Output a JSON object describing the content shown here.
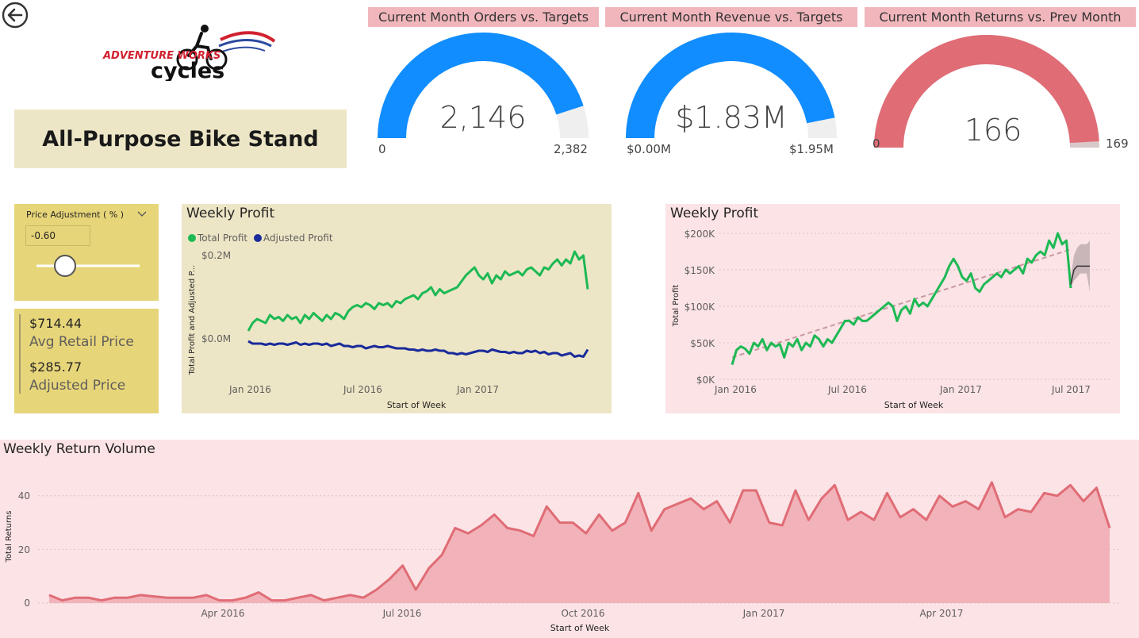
{
  "colors": {
    "gauge_blue": "#118dff",
    "gauge_red": "#e06c75",
    "gauge_track": "#efefef",
    "total_profit": "#1db954",
    "adjusted_profit": "#1a2b9b",
    "returns": "#e06c75",
    "returns_fill": "#f1b3b9"
  },
  "header": {
    "back_icon": "back-arrow-icon",
    "logo_line1": "ADVENTURE WORKS",
    "logo_line2": "cycles",
    "product_name": "All-Purpose Bike Stand"
  },
  "kpis": [
    {
      "title": "Current Month Orders vs. Targets",
      "value": "2,146",
      "min": "0",
      "max": "2,382",
      "fraction": 0.901
    },
    {
      "title": "Current Month Revenue vs. Targets",
      "value": "$1.83M",
      "min": "$0.00M",
      "max": "$1.95M",
      "fraction": 0.938
    },
    {
      "title": "Current Month Returns vs. Prev Month",
      "value": "166",
      "min": "0",
      "max": "169",
      "fraction": 0.982
    }
  ],
  "slicer": {
    "title": "Price Adjustment ( % )",
    "value": "-0.60",
    "slider_fraction": 0.2
  },
  "price_card": {
    "avg_retail_value": "$714.44",
    "avg_retail_label": "Avg Retail Price",
    "adjusted_value": "$285.77",
    "adjusted_label": "Adjusted Price"
  },
  "chart_data": [
    {
      "id": "weekly_profit_adjusted",
      "type": "line",
      "title": "Weekly Profit",
      "legend": [
        "Total Profit",
        "Adjusted Profit"
      ],
      "legend_position": "top-left",
      "xlabel": "Start of Week",
      "ylabel": "Total Profit and Adjusted P...",
      "x_ticks": [
        "Jan 2016",
        "Jul 2016",
        "Jan 2017"
      ],
      "y_ticks": [
        "$0.2M",
        "$0.0M"
      ],
      "ylim": [
        -0.1,
        0.25
      ],
      "x_start": "2016-01-03",
      "x_step_days": 7,
      "series": [
        {
          "name": "Total Profit",
          "values": [
            0.02,
            0.04,
            0.05,
            0.045,
            0.04,
            0.06,
            0.05,
            0.055,
            0.045,
            0.06,
            0.05,
            0.055,
            0.04,
            0.06,
            0.05,
            0.065,
            0.055,
            0.045,
            0.06,
            0.05,
            0.065,
            0.06,
            0.05,
            0.07,
            0.08,
            0.085,
            0.08,
            0.09,
            0.085,
            0.075,
            0.09,
            0.085,
            0.09,
            0.08,
            0.095,
            0.09,
            0.1,
            0.105,
            0.11,
            0.1,
            0.115,
            0.12,
            0.13,
            0.11,
            0.125,
            0.115,
            0.12,
            0.125,
            0.13,
            0.145,
            0.16,
            0.17,
            0.18,
            0.16,
            0.15,
            0.165,
            0.14,
            0.16,
            0.15,
            0.17,
            0.16,
            0.165,
            0.17,
            0.16,
            0.175,
            0.18,
            0.17,
            0.16,
            0.18,
            0.175,
            0.19,
            0.2,
            0.185,
            0.2,
            0.19,
            0.22,
            0.2,
            0.21,
            0.125
          ]
        },
        {
          "name": "Adjusted Profit",
          "values": [
            -0.01,
            -0.02,
            -0.02,
            -0.02,
            -0.025,
            -0.02,
            -0.025,
            -0.02,
            -0.02,
            -0.025,
            -0.02,
            -0.015,
            -0.025,
            -0.02,
            -0.025,
            -0.02,
            -0.02,
            -0.025,
            -0.02,
            -0.03,
            -0.025,
            -0.02,
            -0.03,
            -0.03,
            -0.035,
            -0.03,
            -0.03,
            -0.04,
            -0.035,
            -0.03,
            -0.035,
            -0.035,
            -0.03,
            -0.035,
            -0.04,
            -0.04,
            -0.04,
            -0.045,
            -0.045,
            -0.05,
            -0.045,
            -0.05,
            -0.05,
            -0.045,
            -0.05,
            -0.05,
            -0.06,
            -0.06,
            -0.065,
            -0.06,
            -0.065,
            -0.06,
            -0.055,
            -0.05,
            -0.05,
            -0.055,
            -0.045,
            -0.05,
            -0.055,
            -0.055,
            -0.06,
            -0.055,
            -0.06,
            -0.06,
            -0.05,
            -0.055,
            -0.05,
            -0.06,
            -0.055,
            -0.065,
            -0.06,
            -0.06,
            -0.07,
            -0.065,
            -0.06,
            -0.075,
            -0.07,
            -0.075,
            -0.045
          ]
        }
      ]
    },
    {
      "id": "weekly_profit_forecast",
      "type": "line",
      "title": "Weekly Profit",
      "xlabel": "Start of Week",
      "ylabel": "Total Profit",
      "x_ticks": [
        "Jan 2016",
        "Jul 2016",
        "Jan 2017",
        "Jul 2017"
      ],
      "y_ticks": [
        "$200K",
        "$150K",
        "$100K",
        "$50K",
        "$0K"
      ],
      "ylim": [
        0,
        200
      ],
      "x_start": "2016-01-03",
      "x_step_days": 7,
      "grid": true,
      "series": [
        {
          "name": "Total Profit",
          "values": [
            20,
            40,
            45,
            42,
            35,
            50,
            45,
            55,
            40,
            50,
            45,
            48,
            30,
            50,
            45,
            55,
            40,
            50,
            45,
            60,
            55,
            45,
            55,
            50,
            60,
            70,
            80,
            80,
            75,
            85,
            80,
            80,
            85,
            90,
            95,
            100,
            105,
            100,
            80,
            95,
            100,
            90,
            110,
            100,
            105,
            100,
            110,
            120,
            130,
            140,
            155,
            165,
            155,
            140,
            135,
            145,
            125,
            120,
            130,
            135,
            140,
            145,
            140,
            150,
            145,
            150,
            155,
            145,
            165,
            160,
            170,
            175,
            170,
            190,
            180,
            200,
            185,
            190,
            125
          ]
        },
        {
          "name": "Forecast",
          "values": [
            130,
            150,
            155,
            155,
            155,
            155,
            155
          ]
        }
      ],
      "forecast_band": {
        "upper": [
          140,
          170,
          180,
          185,
          185,
          185,
          190
        ],
        "lower": [
          125,
          135,
          140,
          145,
          145,
          145,
          120
        ]
      },
      "trend_line": {
        "start": 30,
        "end": 178
      }
    },
    {
      "id": "weekly_return_volume",
      "type": "area",
      "title": "Weekly Return Volume",
      "xlabel": "Start of Week",
      "ylabel": "Total Returns",
      "x_ticks": [
        "Apr 2016",
        "Jul 2016",
        "Oct 2016",
        "Jan 2017",
        "Apr 2017"
      ],
      "y_ticks": [
        "40",
        "20",
        "0"
      ],
      "ylim": [
        0,
        50
      ],
      "grid": true,
      "series": [
        {
          "name": "Total Returns",
          "values": [
            3,
            1,
            2,
            2,
            1,
            2,
            2,
            3,
            2.5,
            2,
            2,
            2,
            3,
            1,
            1,
            2,
            4,
            1,
            1,
            2,
            3,
            1,
            2,
            3,
            2,
            5,
            9,
            14,
            5,
            13,
            18,
            28,
            26,
            29,
            33,
            28,
            27,
            25,
            36,
            30,
            30,
            26,
            33,
            27,
            30,
            41,
            27,
            35,
            37,
            39,
            35,
            38,
            30,
            42,
            42,
            30,
            29,
            42,
            31,
            39,
            44,
            31,
            34,
            31,
            41,
            32,
            35,
            31,
            40,
            36,
            38,
            35,
            45,
            32,
            35,
            34,
            41,
            40,
            44,
            38,
            43,
            28
          ]
        }
      ]
    }
  ]
}
